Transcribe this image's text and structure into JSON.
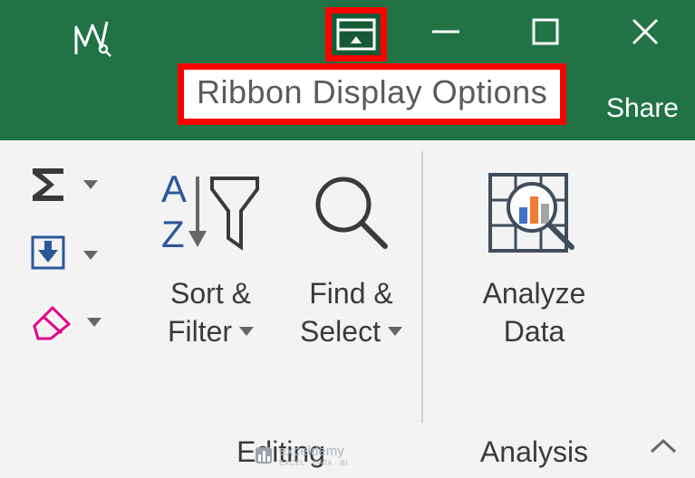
{
  "titlebar": {
    "ribbon_display_tooltip": "Ribbon Display Options",
    "share_label": "Share"
  },
  "ribbon": {
    "autosum_icon": "sigma-icon",
    "fill_icon": "fill-down-icon",
    "clear_icon": "eraser-icon",
    "sort_filter": {
      "label1": "Sort &",
      "label2": "Filter"
    },
    "find_select": {
      "label1": "Find &",
      "label2": "Select"
    },
    "analyze_data": {
      "label1": "Analyze",
      "label2": "Data"
    },
    "group_editing": "Editing",
    "group_analysis": "Analysis"
  },
  "watermark": {
    "brand": "exceldemy",
    "tag": "EXCEL · DATA · BI"
  }
}
